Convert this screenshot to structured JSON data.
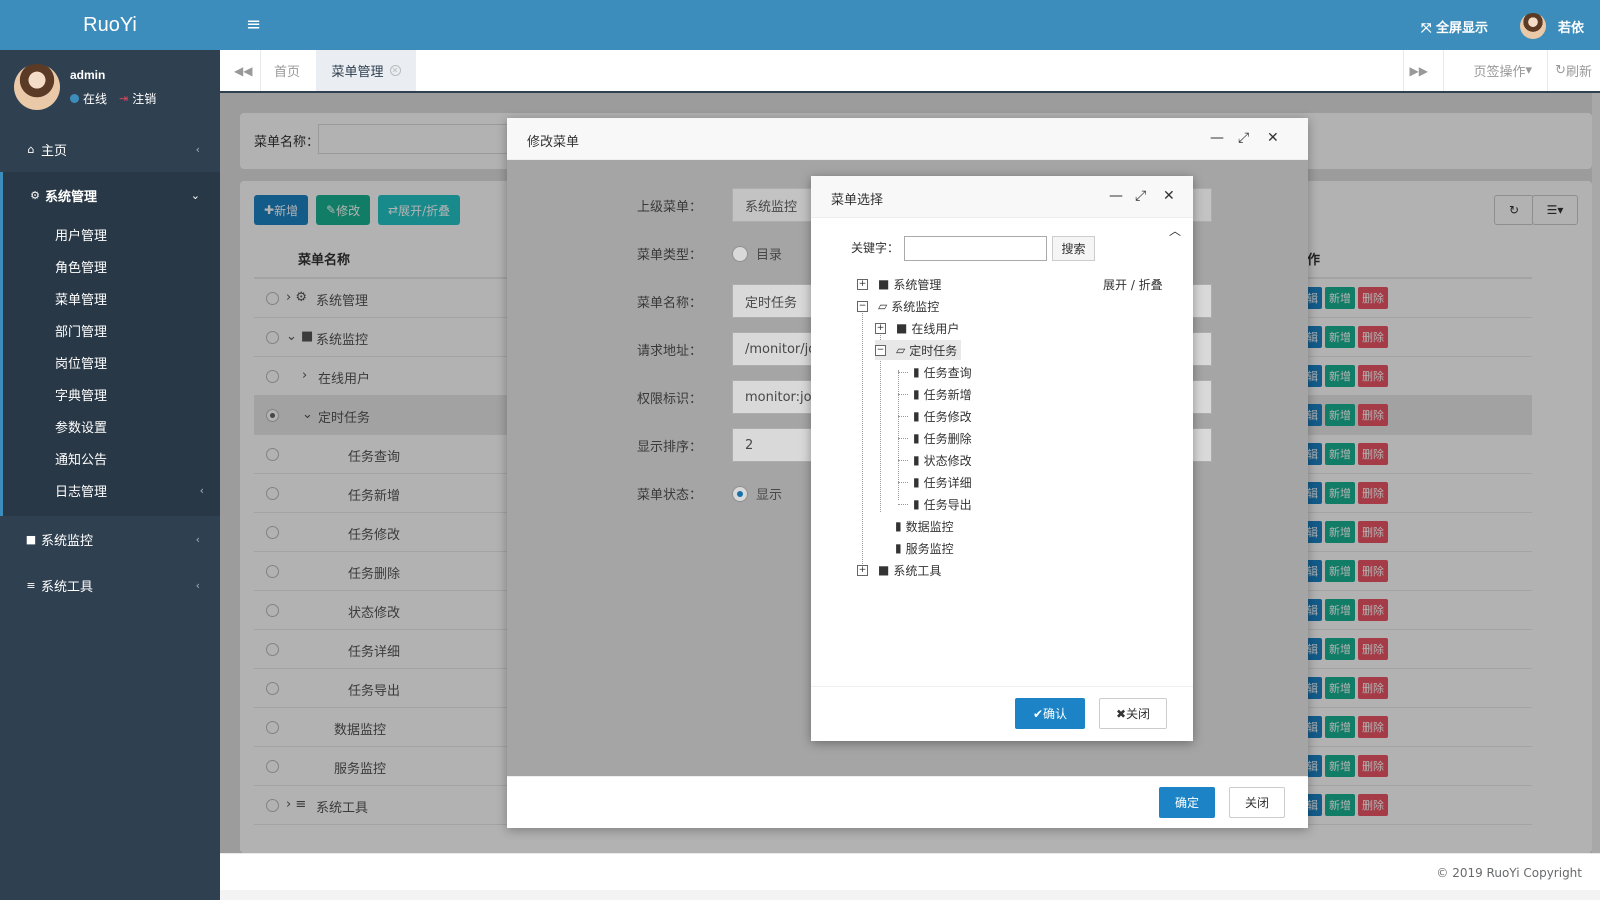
{
  "brand": "RuoYi",
  "user": {
    "name": "admin",
    "status": "在线",
    "logout": "注销"
  },
  "sidebar": {
    "home": "主页",
    "system": "系统管理",
    "system_items": [
      "用户管理",
      "角色管理",
      "菜单管理",
      "部门管理",
      "岗位管理",
      "字典管理",
      "参数设置",
      "通知公告",
      "日志管理"
    ],
    "monitor": "系统监控",
    "tools": "系统工具"
  },
  "topbar": {
    "fullscreen": "全屏显示",
    "username": "若依"
  },
  "tabs": {
    "home": "首页",
    "menu": "菜单管理",
    "ops": "页签操作",
    "refresh": "刷新"
  },
  "search": {
    "label": "菜单名称："
  },
  "toolbar": {
    "add": "新增",
    "edit": "修改",
    "toggle": "展开/折叠"
  },
  "table": {
    "col_name": "菜单名称",
    "col_op": "操作",
    "op_edit": "编辑",
    "op_add": "新增",
    "op_del": "删除",
    "rows": [
      {
        "name": "系统管理",
        "level": 0,
        "icon": "gear",
        "expand": ">"
      },
      {
        "name": "系统监控",
        "level": 0,
        "icon": "video",
        "expand": "v"
      },
      {
        "name": "在线用户",
        "level": 1,
        "icon": "",
        "expand": ">"
      },
      {
        "name": "定时任务",
        "level": 1,
        "icon": "",
        "expand": "v",
        "selected": true
      },
      {
        "name": "任务查询",
        "level": 2
      },
      {
        "name": "任务新增",
        "level": 2
      },
      {
        "name": "任务修改",
        "level": 2
      },
      {
        "name": "任务删除",
        "level": 2
      },
      {
        "name": "状态修改",
        "level": 2
      },
      {
        "name": "任务详细",
        "level": 2
      },
      {
        "name": "任务导出",
        "level": 2
      },
      {
        "name": "数据监控",
        "level": 1
      },
      {
        "name": "服务监控",
        "level": 1
      },
      {
        "name": "系统工具",
        "level": 0,
        "icon": "bars",
        "expand": ">"
      }
    ]
  },
  "footer": {
    "copyright": "© 2019 RuoYi Copyright"
  },
  "modify_dialog": {
    "title": "修改菜单",
    "parent_label": "上级菜单：",
    "parent_value": "系统监控",
    "type_label": "菜单类型：",
    "type_option": "目录",
    "name_label": "菜单名称：",
    "name_value": "定时任务",
    "url_label": "请求地址：",
    "url_value": "/monitor/jo",
    "perm_label": "权限标识：",
    "perm_value": "monitor:job",
    "order_label": "显示排序：",
    "order_value": "2",
    "status_label": "菜单状态：",
    "status_option": "显示",
    "ok": "确定",
    "close": "关闭"
  },
  "select_dialog": {
    "title": "菜单选择",
    "keyword_label": "关键字：",
    "search": "搜索",
    "expand": "展开 / 折叠",
    "tree": {
      "system": "系统管理",
      "monitor": "系统监控",
      "online": "在线用户",
      "job": "定时任务",
      "job_children": [
        "任务查询",
        "任务新增",
        "任务修改",
        "任务删除",
        "状态修改",
        "任务详细",
        "任务导出"
      ],
      "data": "数据监控",
      "server": "服务监控",
      "tools": "系统工具"
    },
    "ok": "确认",
    "close": "关闭"
  }
}
